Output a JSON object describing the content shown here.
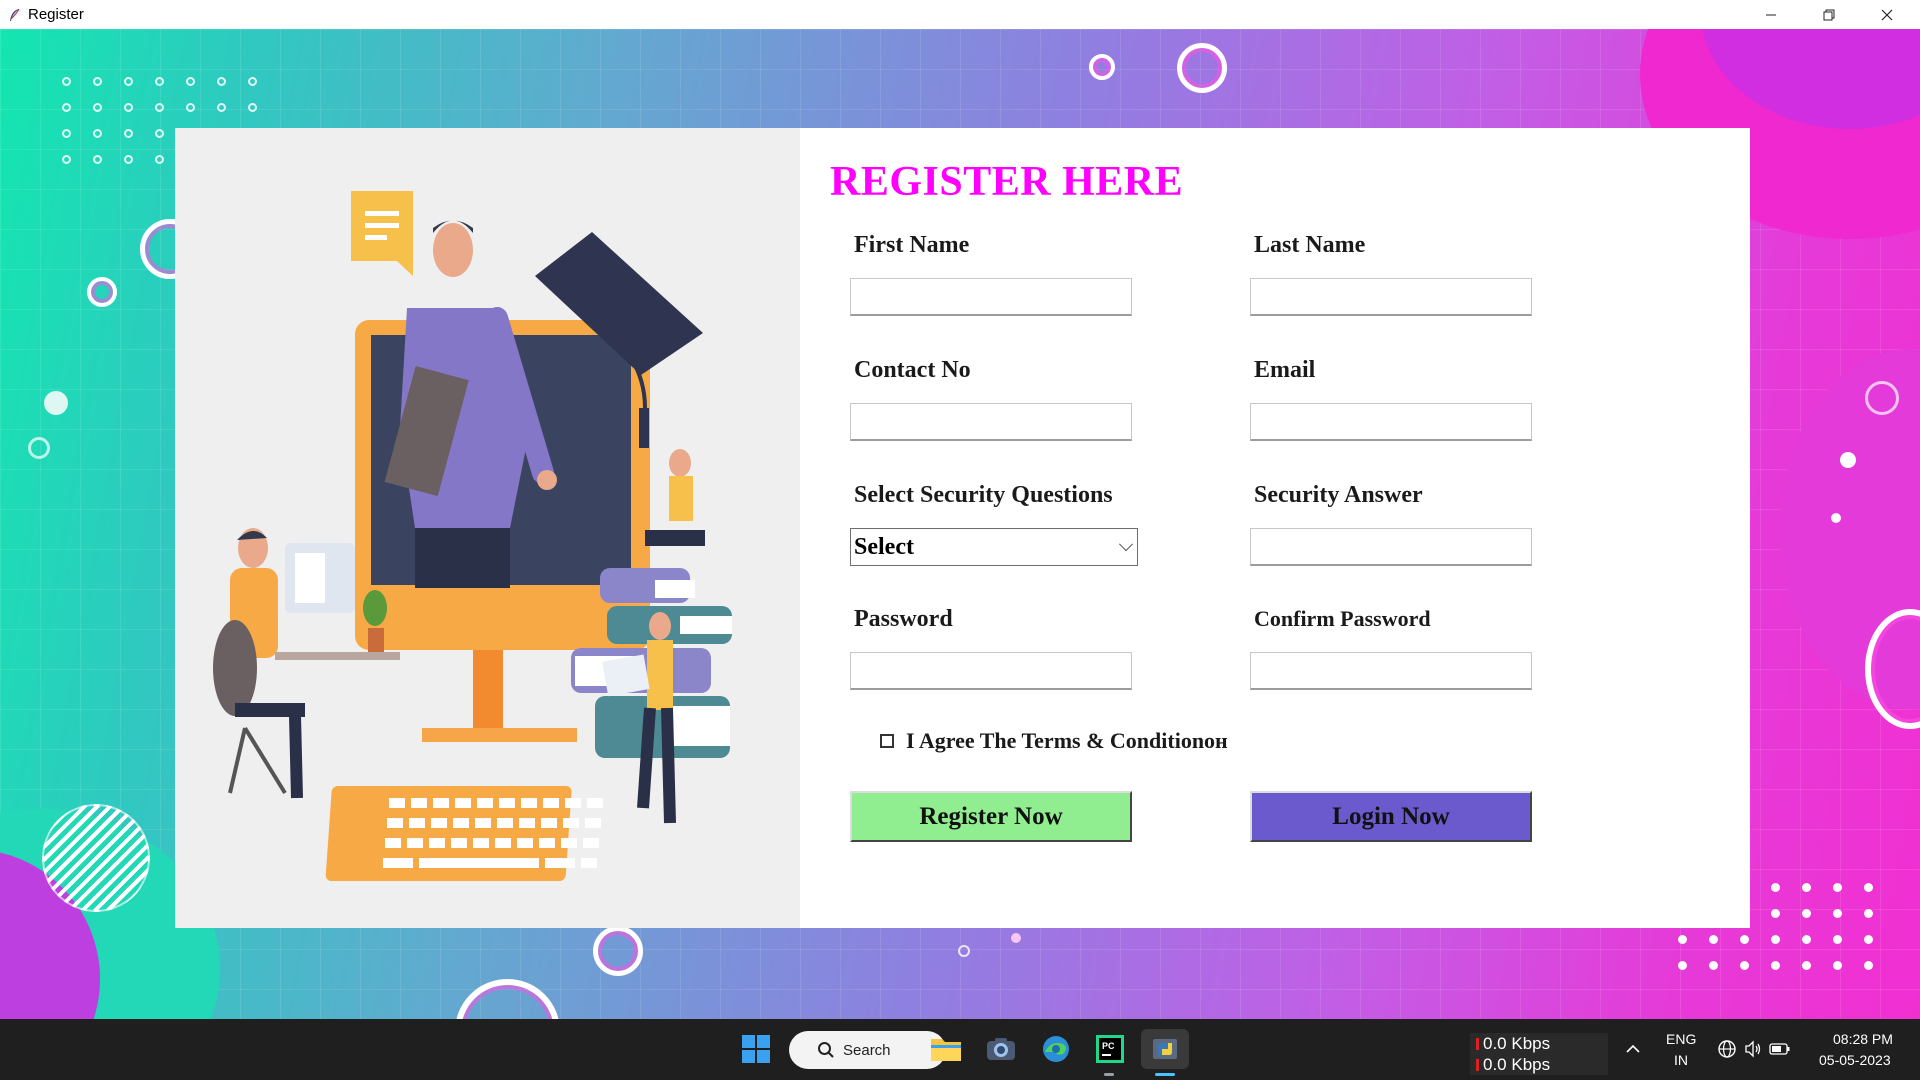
{
  "window": {
    "title": "Register",
    "minimize_icon": "minimize-icon",
    "maximize_icon": "restore-icon",
    "close_icon": "close-icon"
  },
  "colors": {
    "title_color": "#ff00ff",
    "register_button_bg": "#90ee90",
    "login_button_bg": "#6a5acd"
  },
  "form": {
    "heading": "REGISTER HERE",
    "first_name": {
      "label": "First Name",
      "value": ""
    },
    "last_name": {
      "label": "Last Name",
      "value": ""
    },
    "contact_no": {
      "label": "Contact No",
      "value": ""
    },
    "email": {
      "label": "Email",
      "value": ""
    },
    "security_question": {
      "label": "Select Security Questions",
      "selected": "Select"
    },
    "security_answer": {
      "label": "Security Answer",
      "value": ""
    },
    "password": {
      "label": "Password",
      "value": ""
    },
    "confirm_password": {
      "label": "Confirm Password",
      "value": ""
    },
    "terms": {
      "label": "I Agree The Terms &  Conditionон",
      "checked": false
    },
    "register_button": "Register Now",
    "login_button": "Login Now"
  },
  "taskbar": {
    "search_label": "Search",
    "icons": [
      "windows-start-icon",
      "search-icon",
      "file-explorer-icon",
      "camera-icon",
      "edge-icon",
      "pycharm-icon",
      "python-icon"
    ],
    "net_up": "0.0 Kbps",
    "net_down": "0.0 Kbps",
    "lang_top": "ENG",
    "lang_bottom": "IN",
    "time": "08:28 PM",
    "date": "05-05-2023"
  }
}
